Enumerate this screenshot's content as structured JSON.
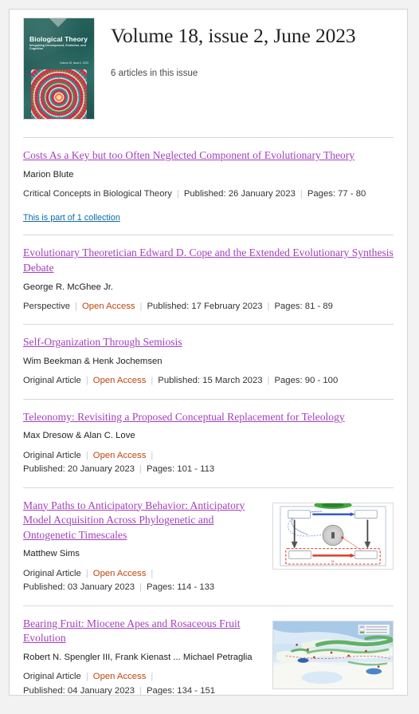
{
  "issue": {
    "title": "Volume 18, issue 2, June 2023",
    "article_count_text": "6 articles in this issue",
    "cover": {
      "journal_title": "Biological Theory",
      "journal_subtitle": "Integrating Development, Evolution, and Cognition",
      "volume_line": "Volume 18, Issue 2, 2023",
      "background_color": "#26655e",
      "alt": "journal-cover-biological-theory"
    }
  },
  "labels": {
    "separator": "|",
    "open_access": "Open Access"
  },
  "articles": [
    {
      "title": "Costs As a Key but too Often Neglected Component of Evolutionary Theory",
      "authors": "Marion Blute",
      "type": "Critical Concepts in Biological Theory",
      "open_access": false,
      "published": "Published: 26 January 2023",
      "pages": "Pages: 77 - 80",
      "collection_link": "This is part of 1 collection",
      "thumbnail": null
    },
    {
      "title": "Evolutionary Theoretician Edward D. Cope and the Extended Evolutionary Synthesis Debate",
      "authors": "George R. McGhee Jr.",
      "type": "Perspective",
      "open_access": true,
      "published": "Published: 17 February 2023",
      "pages": "Pages: 81 - 89",
      "collection_link": null,
      "thumbnail": null
    },
    {
      "title": "Self-Organization Through Semiosis",
      "authors": "Wim Beekman & Henk Jochemsen",
      "type": "Original Article",
      "open_access": true,
      "published": "Published: 15 March 2023",
      "pages": "Pages: 90 - 100",
      "collection_link": null,
      "thumbnail": null
    },
    {
      "title": "Teleonomy: Revisiting a Proposed Conceptual Replacement for Teleology",
      "authors": "Max Dresow & Alan C. Love",
      "type": "Original Article",
      "open_access": true,
      "published": "Published: 20 January 2023",
      "pages": "Pages: 101 - 113",
      "collection_link": null,
      "thumbnail": "diagram-thumbnail"
    },
    {
      "title": "Many Paths to Anticipatory Behavior:  Anticipatory Model Acquisition Across Phylogenetic and Ontogenetic Timescales",
      "authors": "Matthew Sims",
      "type": "Original Article",
      "open_access": true,
      "published": "Published: 03 January 2023",
      "pages": "Pages: 114 - 133",
      "collection_link": null,
      "thumbnail": "diagram-thumbnail"
    },
    {
      "title": "Bearing Fruit: Miocene Apes and Rosaceous Fruit Evolution",
      "authors": "Robert N. Spengler III, Frank Kienast ... Michael Petraglia",
      "type": "Original Article",
      "open_access": true,
      "published": "Published: 04 January 2023",
      "pages": "Pages: 134 - 151",
      "collection_link": null,
      "thumbnail": "map-thumbnail"
    }
  ],
  "colors": {
    "link_visited": "#a43fbd",
    "open_access": "#c1440e",
    "collection_link": "#0b6aa2",
    "divider": "#d8d8d8",
    "page_background": "#f2f2f2"
  }
}
